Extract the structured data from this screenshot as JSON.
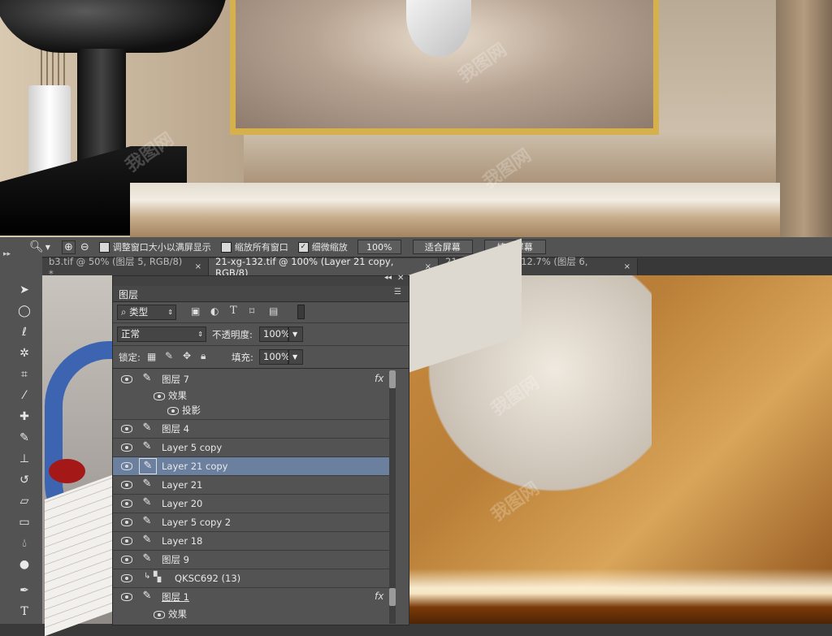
{
  "options_bar": {
    "opt1": "调整窗口大小以满屏显示",
    "opt2": "缩放所有窗口",
    "opt3": "细微缩放",
    "zoom_value": "100%",
    "fit_btn": "适合屏幕",
    "fill_btn": "填充屏幕"
  },
  "tabs": [
    {
      "label": "b3.tif @ 50% (图层 5, RGB/8) *",
      "close": "×"
    },
    {
      "label": "21-xg-132.tif @ 100% (Layer 21 copy, RGB/8)",
      "close": "×"
    },
    {
      "label": "21-xg-131.tif @ 12.7% (图层 6, RGB/8)",
      "close": "×"
    }
  ],
  "layers_panel": {
    "title": "图层",
    "filter_label": "类型",
    "blend_mode": "正常",
    "opacity_label": "不透明度:",
    "opacity_value": "100%",
    "lock_label": "锁定:",
    "fill_label": "填充:",
    "fill_value": "100%",
    "fx_label": "fx",
    "layers": [
      {
        "name": "图层 7",
        "fx": true
      },
      {
        "name": "效果",
        "sub": true
      },
      {
        "name": "投影",
        "sub2": true
      },
      {
        "name": "图层 4"
      },
      {
        "name": "Layer 5 copy"
      },
      {
        "name": "Layer 21 copy",
        "selected": true
      },
      {
        "name": "Layer 21"
      },
      {
        "name": "Layer 20"
      },
      {
        "name": "Layer 5 copy 2"
      },
      {
        "name": "Layer 18"
      },
      {
        "name": "图层 9"
      },
      {
        "name": "QKSC692 (13)",
        "smart": true
      },
      {
        "name": "图层 1",
        "fx": true
      },
      {
        "name": "效果",
        "sub": true
      }
    ]
  },
  "watermark": "我图网",
  "colors": {
    "accent_selected": "#6b7f9e",
    "panel_bg": "#535353"
  }
}
